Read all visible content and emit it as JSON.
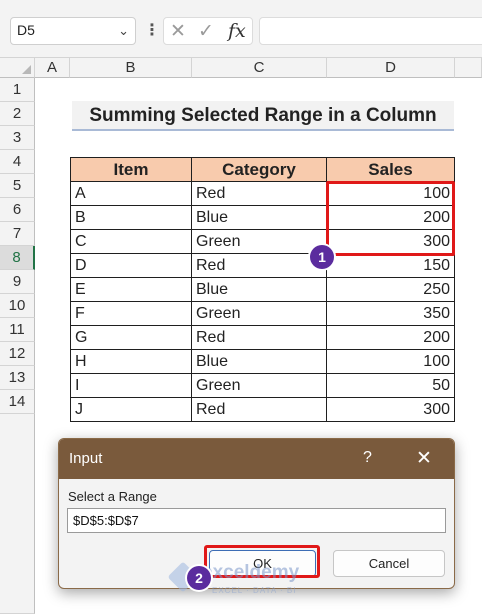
{
  "formula_bar": {
    "name_box": "D5",
    "fx_label": "fx",
    "formula": ""
  },
  "columns": [
    "A",
    "B",
    "C",
    "D"
  ],
  "rows": [
    "1",
    "2",
    "3",
    "4",
    "5",
    "6",
    "7",
    "8",
    "9",
    "10",
    "11",
    "12",
    "13",
    "14"
  ],
  "selected_row": "8",
  "sheet_title": "Summing Selected Range in a Column",
  "table": {
    "headers": [
      "Item",
      "Category",
      "Sales"
    ],
    "rows": [
      [
        "A",
        "Red",
        "100"
      ],
      [
        "B",
        "Blue",
        "200"
      ],
      [
        "C",
        "Green",
        "300"
      ],
      [
        "D",
        "Red",
        "150"
      ],
      [
        "E",
        "Blue",
        "250"
      ],
      [
        "F",
        "Green",
        "350"
      ],
      [
        "G",
        "Red",
        "200"
      ],
      [
        "H",
        "Blue",
        "100"
      ],
      [
        "I",
        "Green",
        "50"
      ],
      [
        "J",
        "Red",
        "300"
      ]
    ]
  },
  "markers": {
    "step1": "1",
    "step2": "2"
  },
  "dialog": {
    "title": "Input",
    "help": "?",
    "close": "✕",
    "prompt": "Select a Range",
    "value": "$D$5:$D$7",
    "ok_label": "OK",
    "cancel_label": "Cancel"
  },
  "watermark": {
    "name": "exceldemy",
    "tagline": "EXCEL · DATA · BI"
  },
  "colors": {
    "header_fill": "#f8cbad",
    "highlight": "#e01818",
    "badge": "#5b2c9e",
    "dialog_title_bar": "#7a5a3c"
  }
}
